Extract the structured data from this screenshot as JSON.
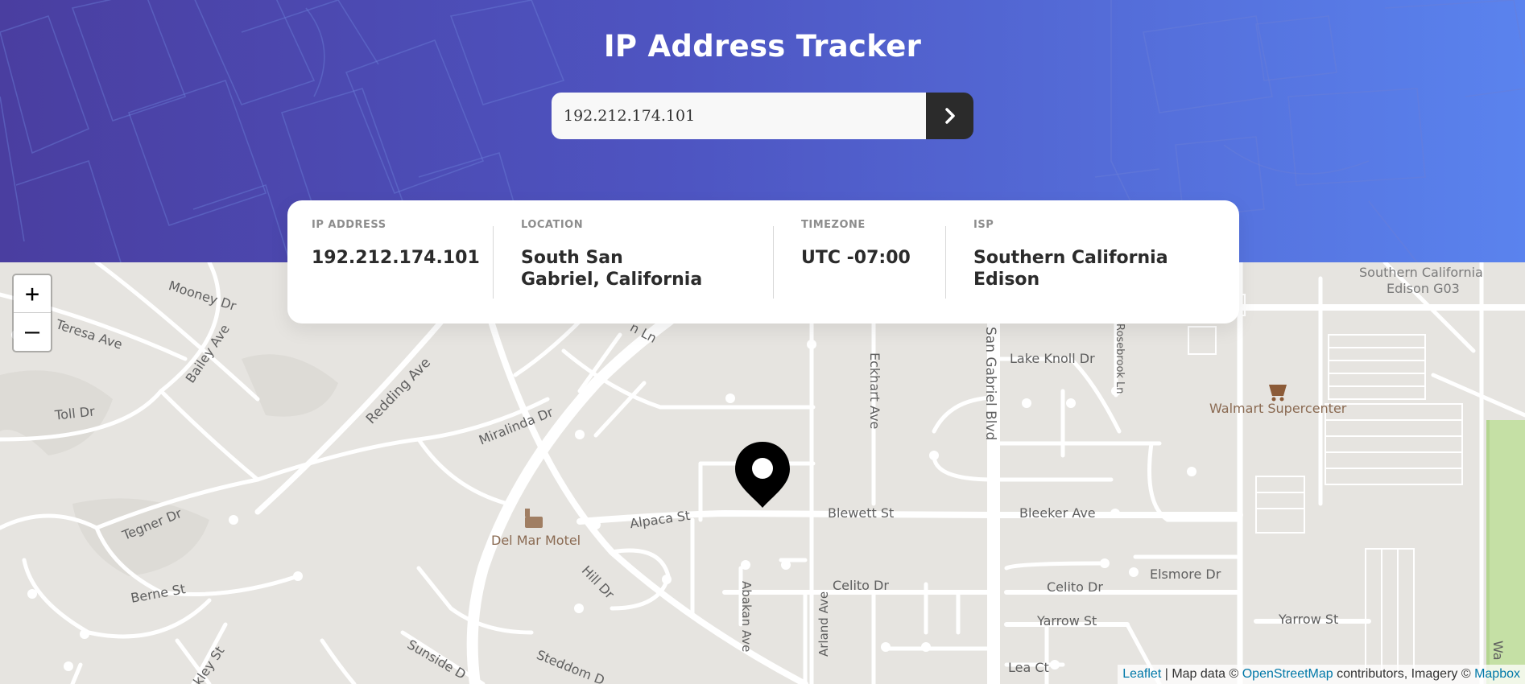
{
  "header": {
    "title": "IP Address Tracker",
    "search": {
      "value": "192.212.174.101",
      "submit_icon": "chevron-right-icon"
    }
  },
  "info": {
    "ip": {
      "label": "IP ADDRESS",
      "value": "192.212.174.101"
    },
    "location": {
      "label": "LOCATION",
      "value": "South San Gabriel, California"
    },
    "timezone": {
      "label": "TIMEZONE",
      "value": "UTC -07:00"
    },
    "isp": {
      "label": "ISP",
      "value": "Southern California Edison"
    }
  },
  "map": {
    "zoom_in": "+",
    "zoom_out": "–",
    "marker_icon": "location-pin-icon",
    "streets": {
      "mooney_dr": "Mooney Dr",
      "teresa_ave": "Teresa Ave",
      "bailey_ave": "Bailey Ave",
      "toll_dr": "Toll Dr",
      "redding_ave": "Redding Ave",
      "miralinda_dr": "Miralinda Dr",
      "tegner_dr": "Tegner Dr",
      "berne_st": "Berne St",
      "alpaca_st": "Alpaca St",
      "hill_dr": "Hill Dr",
      "sunside_dr": "Sunside D",
      "steddom_dr": "Steddom D",
      "kley_st": "kley St",
      "blewett_st": "Blewett St",
      "bleeker_ave": "Bleeker Ave",
      "eckhart_ave": "Eckhart Ave",
      "san_gabriel_blvd": "San Gabriel Blvd",
      "lake_knoll_dr": "Lake Knoll Dr",
      "rosebrook_ln": "Rosebrook Ln",
      "celito_dr_1": "Celito Dr",
      "celito_dr_2": "Celito Dr",
      "elsmore_dr": "Elsmore Dr",
      "yarrow_st_1": "Yarrow St",
      "yarrow_st_2": "Yarrow St",
      "abakan_ave": "Abakan Ave",
      "arland_ave": "Arland Ave",
      "lea_ct": "Lea Ct",
      "n_ln": "n Ln",
      "wal": "Wa"
    },
    "pois": {
      "del_mar_motel": "Del Mar Motel",
      "walmart": "Walmart Supercenter",
      "sce_line1": "Southern California",
      "sce_line2": "Edison G03"
    },
    "attribution": {
      "leaflet": "Leaflet",
      "sep": " | Map data © ",
      "osm": "OpenStreetMap",
      "mid": " contributors, Imagery © ",
      "mapbox": "Mapbox"
    }
  }
}
